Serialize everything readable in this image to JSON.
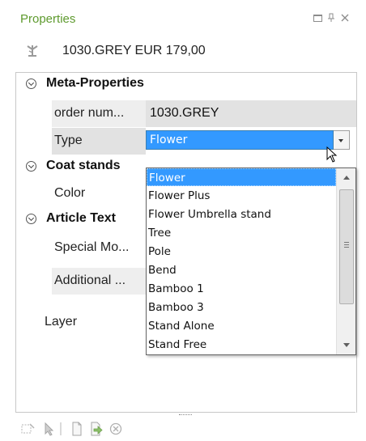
{
  "window": {
    "title": "Properties",
    "buttons": {
      "minimize": "minimize-icon",
      "pin": "pin-icon",
      "close": "close-icon"
    }
  },
  "selected_object": {
    "icon": "coat-stand-icon",
    "label": "1030.GREY EUR 179,00"
  },
  "grid": {
    "categories": [
      {
        "label": "Meta-Properties"
      },
      {
        "label": "Coat stands"
      },
      {
        "label": "Article Text"
      }
    ],
    "properties": {
      "order_number": {
        "name": "order num...",
        "value": "1030.GREY"
      },
      "type": {
        "name": "Type",
        "value": "Flower"
      },
      "color": {
        "name": "Color",
        "value": ""
      },
      "special": {
        "name": "Special Mo...",
        "value": ""
      },
      "additional": {
        "name": "Additional ...",
        "value": ""
      },
      "layer": {
        "name": "Layer",
        "value": ""
      }
    }
  },
  "dropdown": {
    "selected": "Flower",
    "options": [
      "Flower",
      "Flower Plus",
      "Flower Umbrella stand",
      "Tree",
      "Pole",
      "Bend",
      "Bamboo 1",
      "Bamboo 3",
      "Stand Alone",
      "Stand Free"
    ]
  },
  "toolbar": {
    "icons": [
      "select-icon",
      "pointer-icon",
      "new-page-icon",
      "import-icon",
      "cancel-icon"
    ]
  },
  "colors": {
    "title": "#5e9a2e",
    "selection": "#3399ff"
  }
}
